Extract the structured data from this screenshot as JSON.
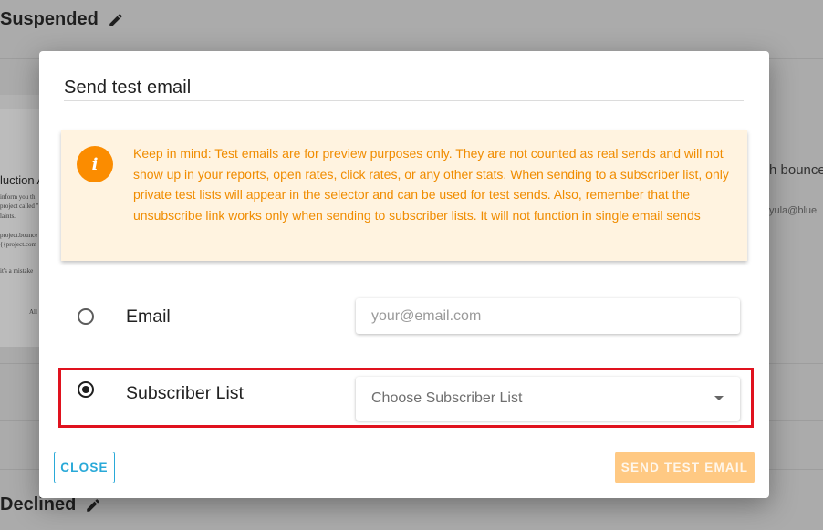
{
  "background": {
    "heading_top": "Suspended",
    "heading_bottom": "Declined",
    "left_fragments": [
      "luction A",
      "inform you th",
      "project called \"",
      "laints.",
      "project.bounce",
      "{{project.com",
      "it's a mistake",
      "All"
    ],
    "right_fragments": [
      "h bounce",
      "yula@blue"
    ]
  },
  "modal": {
    "title": "Send test email",
    "notice": {
      "icon": "info-icon",
      "text": "Keep in mind: Test emails are for preview purposes only. They are not counted as real sends and will not show up in your reports, open rates, click rates, or any other stats. When sending to a subscriber list, only private test lists will appear in the selector and can be used for test sends. Also, remember that the unsubscribe link works only when sending to subscriber lists. It will not function in single email sends",
      "background_color": "#fff3e0",
      "text_color": "#f08c00",
      "icon_color": "#fb8c00"
    },
    "options": [
      {
        "label": "Email",
        "selected": false,
        "placeholder": "your@email.com",
        "value": ""
      },
      {
        "label": "Subscriber List",
        "selected": true,
        "placeholder": "Choose Subscriber List"
      }
    ],
    "buttons": {
      "close": "CLOSE",
      "send": "SEND TEST EMAIL"
    },
    "colors": {
      "close_accent": "#29a9d8",
      "send_accent": "#ffc983",
      "highlight_border": "#e0121e"
    }
  }
}
